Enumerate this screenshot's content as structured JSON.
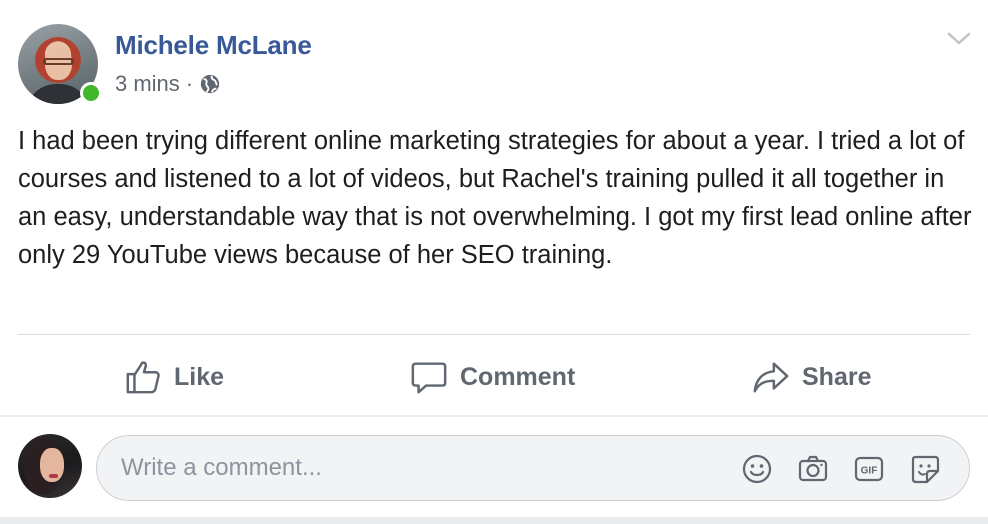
{
  "post": {
    "author": "Michele McLane",
    "time": "3 mins",
    "separator": "·",
    "privacy_icon": "globe-icon",
    "text": "I had been trying different online marketing strategies for about a year. I tried a lot of courses and listened to a lot of videos, but Rachel's training pulled it all together in an easy, understandable way that is not overwhelming. I got my first lead online after only 29 YouTube views because of her SEO training."
  },
  "actions": {
    "like": "Like",
    "comment": "Comment",
    "share": "Share"
  },
  "composer": {
    "placeholder": "Write a comment...",
    "icons": [
      "emoji-icon",
      "camera-icon",
      "gif-icon",
      "sticker-icon"
    ]
  },
  "colors": {
    "author": "#385898",
    "online": "#42b72a",
    "muted": "#606770"
  }
}
